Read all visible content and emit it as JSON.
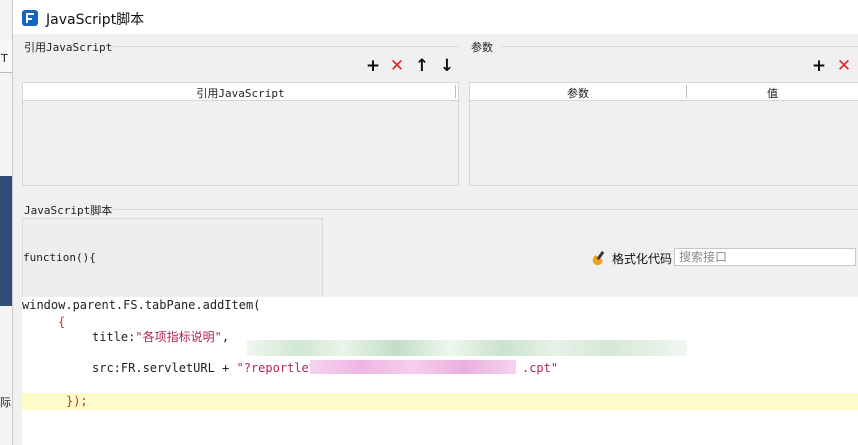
{
  "background_app": {
    "side_text_top": "T",
    "side_text_bottom": "际"
  },
  "window": {
    "title": "JavaScript脚本",
    "icon": "app-logo-icon"
  },
  "left_panel": {
    "label": "引用JavaScript",
    "toolbar": {
      "add": "+",
      "delete": "✕",
      "up": "↑",
      "down": "↓"
    },
    "table": {
      "columns": [
        "引用JavaScript"
      ],
      "rows": []
    }
  },
  "right_panel": {
    "label": "参数",
    "toolbar": {
      "add": "+",
      "delete": "✕"
    },
    "table": {
      "columns": [
        "参数",
        "值"
      ],
      "rows": []
    }
  },
  "script_section": {
    "label": "JavaScript脚本",
    "function_header": "function(){",
    "format_button": "格式化代码",
    "search_placeholder": "搜索接口",
    "code": {
      "line1": "window.parent.FS.tabPane.addItem(",
      "line2": "{",
      "line3_key": "title:",
      "line3_value": "\"各项指标说明\"",
      "line3_end": ",",
      "line5_key": "src:FR.servletURL + ",
      "line5_value_a": "\"?reportlet",
      "line5_value_b": ".cpt\"",
      "line7": "});"
    }
  },
  "colors": {
    "accent": "#1565c0",
    "delete": "#e02424",
    "string": "#b0245a",
    "current_line": "#fdfbc8"
  }
}
